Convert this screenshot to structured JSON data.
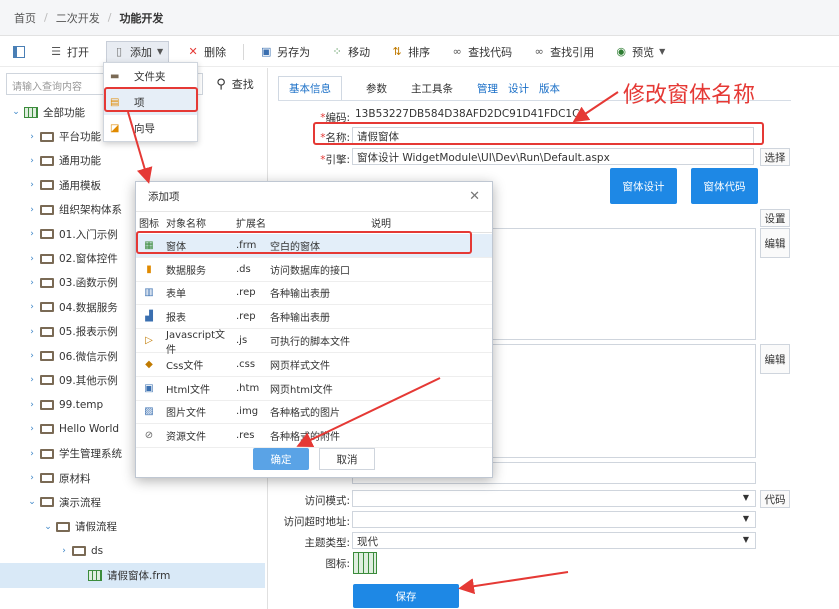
{
  "breadcrumb": [
    "首页",
    "二次开发",
    "功能开发"
  ],
  "toolbar": {
    "open": "打开",
    "add": "添加",
    "delete": "删除",
    "save_as": "另存为",
    "move": "移动",
    "sort": "排序",
    "find_code": "查找代码",
    "find_ref": "查找引用",
    "preview": "预览"
  },
  "search": {
    "placeholder": "请输入查询内容",
    "button": "查找"
  },
  "dropdown": [
    "文件夹",
    "项",
    "向导"
  ],
  "tree": [
    {
      "label": "全部功能",
      "level": 0,
      "arrow": "v"
    },
    {
      "label": "平台功能",
      "level": 1,
      "arrow": ">"
    },
    {
      "label": "通用功能",
      "level": 1,
      "arrow": ">"
    },
    {
      "label": "通用模板",
      "level": 1,
      "arrow": ">"
    },
    {
      "label": "组织架构体系",
      "level": 1,
      "arrow": ">"
    },
    {
      "label": "01.入门示例",
      "level": 1,
      "arrow": ">"
    },
    {
      "label": "02.窗体控件",
      "level": 1,
      "arrow": ">"
    },
    {
      "label": "03.函数示例",
      "level": 1,
      "arrow": ">"
    },
    {
      "label": "04.数据服务",
      "level": 1,
      "arrow": ">"
    },
    {
      "label": "05.报表示例",
      "level": 1,
      "arrow": ">"
    },
    {
      "label": "06.微信示例",
      "level": 1,
      "arrow": ">"
    },
    {
      "label": "09.其他示例",
      "level": 1,
      "arrow": ">"
    },
    {
      "label": "99.temp",
      "level": 1,
      "arrow": ">"
    },
    {
      "label": "Hello World",
      "level": 1,
      "arrow": ">"
    },
    {
      "label": "学生管理系统",
      "level": 1,
      "arrow": ">"
    },
    {
      "label": "原材料",
      "level": 1,
      "arrow": ">"
    },
    {
      "label": "演示流程",
      "level": 1,
      "arrow": "v"
    },
    {
      "label": "请假流程",
      "level": 2,
      "arrow": "v"
    },
    {
      "label": "ds",
      "level": 3,
      "arrow": ">"
    },
    {
      "label": "请假窗体.frm",
      "level": 4,
      "arrow": ""
    }
  ],
  "tabs": [
    "基本信息",
    "参数",
    "主工具条",
    "管理",
    "设计",
    "版本"
  ],
  "form": {
    "code_label": "编码:",
    "code_value": "13B53227DB584D38AFD2DC91D41FDC1C",
    "name_label": "名称:",
    "name_value": "请假窗体",
    "engine_label": "引擎:",
    "engine_value": "窗体设计 WidgetModule\\UI\\Dev\\Run\\Default.aspx",
    "select_btn": "选择",
    "design_btn": "窗体设计",
    "code_btn": "窗体代码",
    "settings_btn": "设置",
    "edit_btn1": "编辑",
    "edit_btn2": "编辑",
    "access_mode_label": "访问模式:",
    "access_timeout_label": "访问超时地址:",
    "theme_label": "主题类型:",
    "theme_value": "现代",
    "icon_label": "图标:",
    "code_link_btn": "代码",
    "save_btn": "保存"
  },
  "annotation": "修改窗体名称",
  "dialog": {
    "title": "添加项",
    "headers": [
      "图标",
      "对象名称",
      "扩展名",
      "说明"
    ],
    "rows": [
      {
        "name": "窗体",
        "ext": ".frm",
        "desc": "空白的窗体"
      },
      {
        "name": "数据服务",
        "ext": ".ds",
        "desc": "访问数据库的接口"
      },
      {
        "name": "表单",
        "ext": ".rep",
        "desc": "各种输出表册"
      },
      {
        "name": "报表",
        "ext": ".rep",
        "desc": "各种输出表册"
      },
      {
        "name": "Javascript文件",
        "ext": ".js",
        "desc": "可执行的脚本文件"
      },
      {
        "name": "Css文件",
        "ext": ".css",
        "desc": "网页样式文件"
      },
      {
        "name": "Html文件",
        "ext": ".htm",
        "desc": "网页html文件"
      },
      {
        "name": "图片文件",
        "ext": ".img",
        "desc": "各种格式的图片"
      },
      {
        "name": "资源文件",
        "ext": ".res",
        "desc": "各种格式的附件"
      }
    ],
    "ok": "确定",
    "cancel": "取消"
  }
}
